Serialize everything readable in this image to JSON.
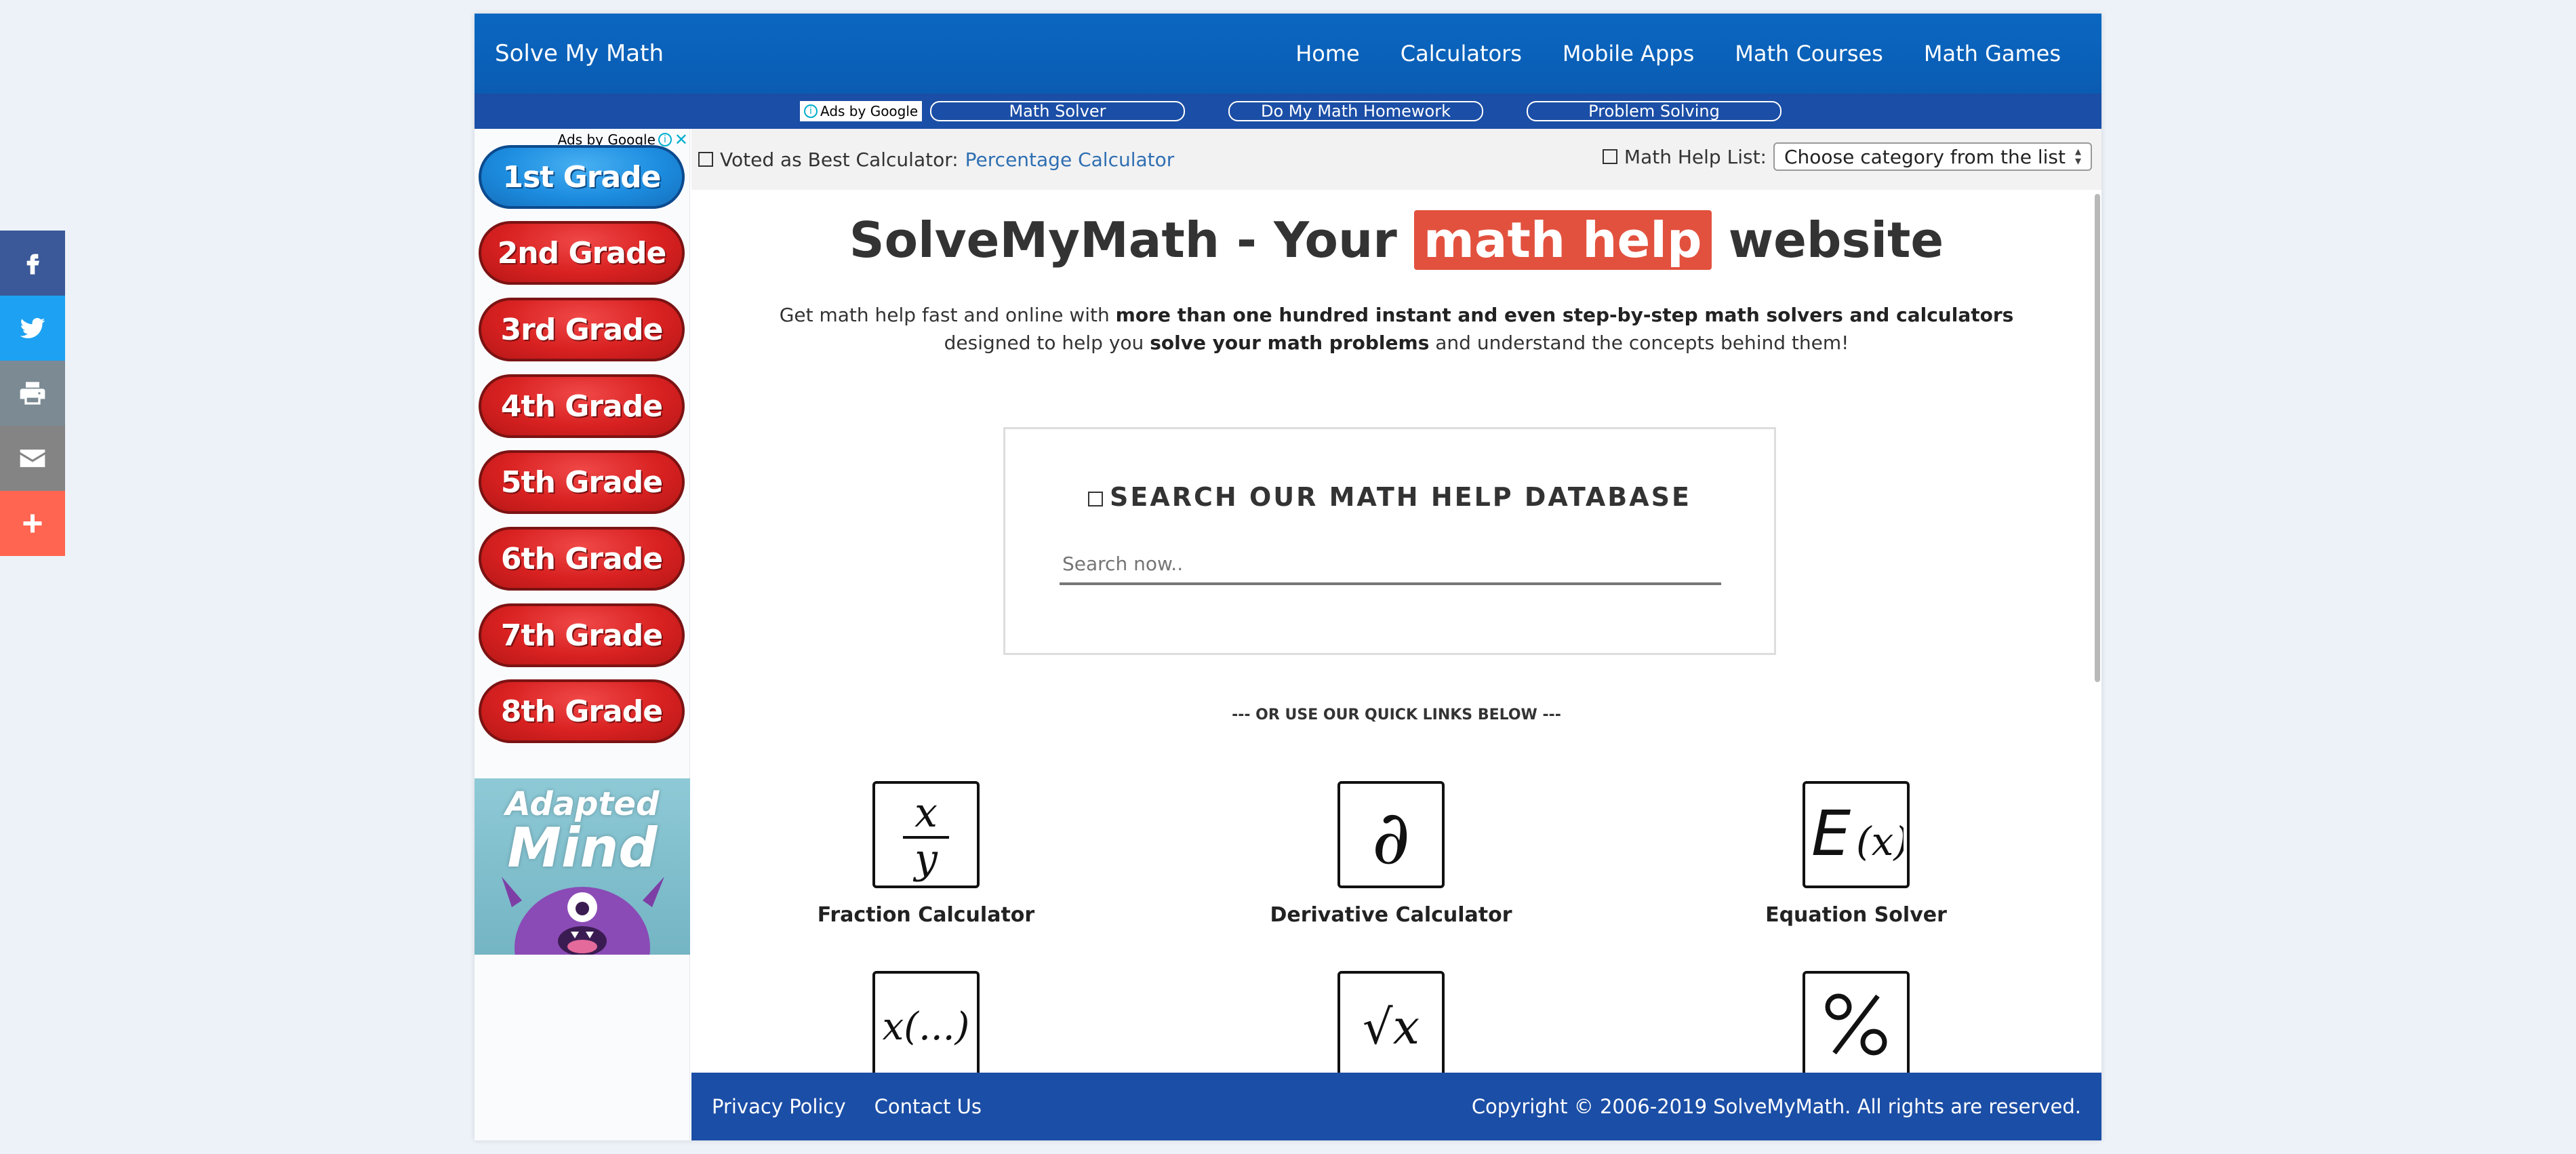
{
  "social": {
    "items": [
      {
        "name": "facebook-icon",
        "glyph": "f"
      },
      {
        "name": "twitter-icon",
        "glyph": "t"
      },
      {
        "name": "print-icon",
        "glyph": "p"
      },
      {
        "name": "email-icon",
        "glyph": "e"
      },
      {
        "name": "more-icon",
        "glyph": "+"
      }
    ]
  },
  "header": {
    "brand": "Solve My Math",
    "nav": [
      "Home",
      "Calculators",
      "Mobile Apps",
      "Math Courses",
      "Math Games"
    ]
  },
  "adbar": {
    "ads_by": "Ads by Google",
    "links": [
      "Math Solver",
      "Do My Math Homework",
      "Problem Solving"
    ]
  },
  "left_ad": {
    "ads_by": "Ads by Google",
    "grades": [
      "1st Grade",
      "2nd Grade",
      "3rd Grade",
      "4th Grade",
      "5th Grade",
      "6th Grade",
      "7th Grade",
      "8th Grade"
    ],
    "brand_line1": "Adapted",
    "brand_line2": "Mind"
  },
  "toolbar": {
    "voted_label": "Voted as Best Calculator:",
    "voted_link": "Percentage Calculator",
    "help_list_label": "Math Help List:",
    "help_list_selected": "Choose category from the list"
  },
  "hero": {
    "title_before": "SolveMyMath - Your ",
    "title_highlight": "math help",
    "title_after": " website",
    "intro_1": "Get math help fast and online with ",
    "intro_bold_1": "more than one hundred instant and even step-by-step math solvers and calculators",
    "intro_2": " designed to help you ",
    "intro_bold_2": "solve your math problems",
    "intro_3": " and understand the concepts behind them!"
  },
  "search": {
    "title": "SEARCH OUR MATH HELP DATABASE",
    "placeholder": "Search now.."
  },
  "quick_links_heading": "--- OR USE OUR QUICK LINKS BELOW ---",
  "tiles": [
    {
      "label": "Fraction Calculator",
      "icon": "fraction-icon"
    },
    {
      "label": "Derivative Calculator",
      "icon": "partial-derivative-icon"
    },
    {
      "label": "Equation Solver",
      "icon": "equation-icon"
    },
    {
      "label": "",
      "icon": "function-icon"
    },
    {
      "label": "",
      "icon": "square-root-icon"
    },
    {
      "label": "",
      "icon": "percent-icon"
    }
  ],
  "footer": {
    "privacy": "Privacy Policy",
    "contact": "Contact Us",
    "copyright": "Copyright © 2006-2019 SolveMyMath. All rights are reserved."
  },
  "colors": {
    "nav_blue": "#0b67c2",
    "bar_blue": "#1b4ea6",
    "highlight_red": "#e2513e",
    "grade_red": "#d92121",
    "grade_blue": "#1d8de0"
  }
}
